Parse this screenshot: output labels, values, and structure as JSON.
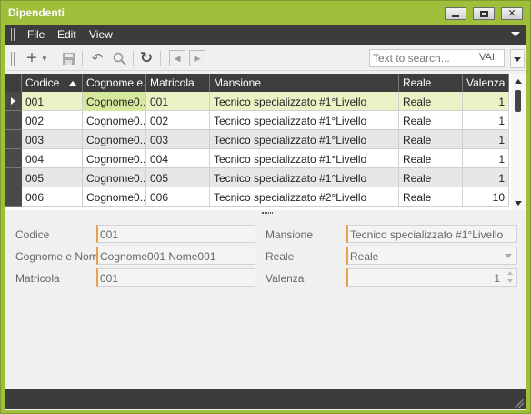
{
  "window": {
    "title": "Dipendenti"
  },
  "menu": {
    "items": [
      "File",
      "Edit",
      "View"
    ]
  },
  "toolbar": {
    "icons": [
      "add-icon",
      "save-icon",
      "undo-icon",
      "zoom-icon",
      "refresh-icon",
      "prev-icon",
      "next-icon"
    ],
    "search_placeholder": "Text to search...",
    "search_button": "VAI!"
  },
  "grid": {
    "columns": [
      "Codice",
      "Cognome e...",
      "Matricola",
      "Mansione",
      "Reale",
      "Valenza"
    ],
    "rows": [
      {
        "codice": "001",
        "nome": "Cognome0...",
        "matricola": "001",
        "mansione": "Tecnico specializzato #1°Livello",
        "reale": "Reale",
        "valenza": "1"
      },
      {
        "codice": "002",
        "nome": "Cognome0...",
        "matricola": "002",
        "mansione": "Tecnico specializzato #1°Livello",
        "reale": "Reale",
        "valenza": "1"
      },
      {
        "codice": "003",
        "nome": "Cognome0...",
        "matricola": "003",
        "mansione": "Tecnico specializzato #1°Livello",
        "reale": "Reale",
        "valenza": "1"
      },
      {
        "codice": "004",
        "nome": "Cognome0...",
        "matricola": "004",
        "mansione": "Tecnico specializzato #1°Livello",
        "reale": "Reale",
        "valenza": "1"
      },
      {
        "codice": "005",
        "nome": "Cognome0...",
        "matricola": "005",
        "mansione": "Tecnico specializzato #1°Livello",
        "reale": "Reale",
        "valenza": "1"
      },
      {
        "codice": "006",
        "nome": "Cognome0...",
        "matricola": "006",
        "mansione": "Tecnico specializzato #2°Livello",
        "reale": "Reale",
        "valenza": "10"
      }
    ]
  },
  "form": {
    "codice_label": "Codice",
    "codice_value": "001",
    "nome_label": "Cognome e Nome",
    "nome_value": "Cognome001 Nome001",
    "matricola_label": "Matricola",
    "matricola_value": "001",
    "mansione_label": "Mansione",
    "mansione_value": "Tecnico specializzato #1°Livello",
    "reale_label": "Reale",
    "reale_value": "Reale",
    "valenza_label": "Valenza",
    "valenza_value": "1"
  },
  "colors": {
    "accent": "#9fbf3b",
    "selected_row": "#e9f3c5",
    "dark_bar": "#3c3c3c",
    "field_accent": "#e8a04b"
  }
}
